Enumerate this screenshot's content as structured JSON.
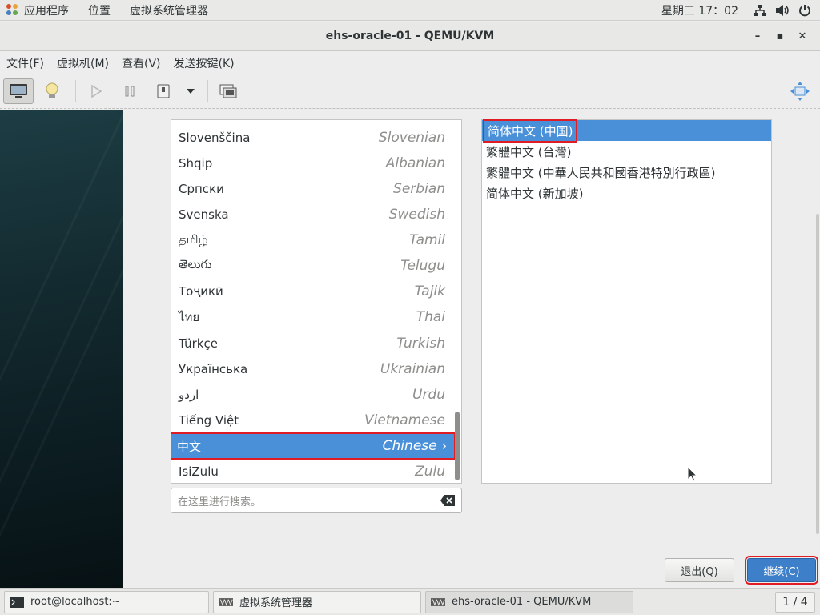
{
  "topbar": {
    "apps_label": "应用程序",
    "places_label": "位置",
    "app_menu_label": "虚拟系统管理器",
    "clock": "星期三 17：02"
  },
  "window": {
    "title": "ehs-oracle-01 - QEMU/KVM",
    "minimize": "–",
    "maximize": "▪",
    "close": "✕"
  },
  "menubar": {
    "items": [
      "文件(F)",
      "虚拟机(M)",
      "查看(V)",
      "发送按键(K)"
    ]
  },
  "installer": {
    "languages": [
      {
        "native": "Slovenščina",
        "english": "Slovenian"
      },
      {
        "native": "Shqip",
        "english": "Albanian"
      },
      {
        "native": "Српски",
        "english": "Serbian"
      },
      {
        "native": "Svenska",
        "english": "Swedish"
      },
      {
        "native": "தமிழ்",
        "english": "Tamil"
      },
      {
        "native": "తెలుగు",
        "english": "Telugu"
      },
      {
        "native": "Тоҷикӣ",
        "english": "Tajik"
      },
      {
        "native": "ไทย",
        "english": "Thai"
      },
      {
        "native": "Türkçe",
        "english": "Turkish"
      },
      {
        "native": "Українська",
        "english": "Ukrainian"
      },
      {
        "native": "اردو",
        "english": "Urdu"
      },
      {
        "native": "Tiếng Việt",
        "english": "Vietnamese"
      },
      {
        "native": "中文",
        "english": "Chinese"
      },
      {
        "native": "IsiZulu",
        "english": "Zulu"
      }
    ],
    "selected_language_index": 12,
    "search_placeholder": "在这里进行搜索。",
    "locales": [
      "简体中文 (中国)",
      "繁體中文 (台灣)",
      "繁體中文 (中華人民共和國香港特別行政區)",
      "简体中文 (新加坡)"
    ],
    "selected_locale_index": 0,
    "quit_label": "退出(Q)",
    "continue_label": "继续(C)"
  },
  "taskbar": {
    "tasks": [
      {
        "label": "root@localhost:~",
        "icon": "terminal-icon"
      },
      {
        "label": "虚拟系统管理器",
        "icon": "virt-manager-icon"
      },
      {
        "label": "ehs-oracle-01 - QEMU/KVM",
        "icon": "virt-manager-icon"
      }
    ],
    "pager": "1 / 4"
  },
  "colors": {
    "selection": "#4a90d9",
    "highlight_outline": "#e01b24",
    "continue_button": "#3d7fc8"
  }
}
